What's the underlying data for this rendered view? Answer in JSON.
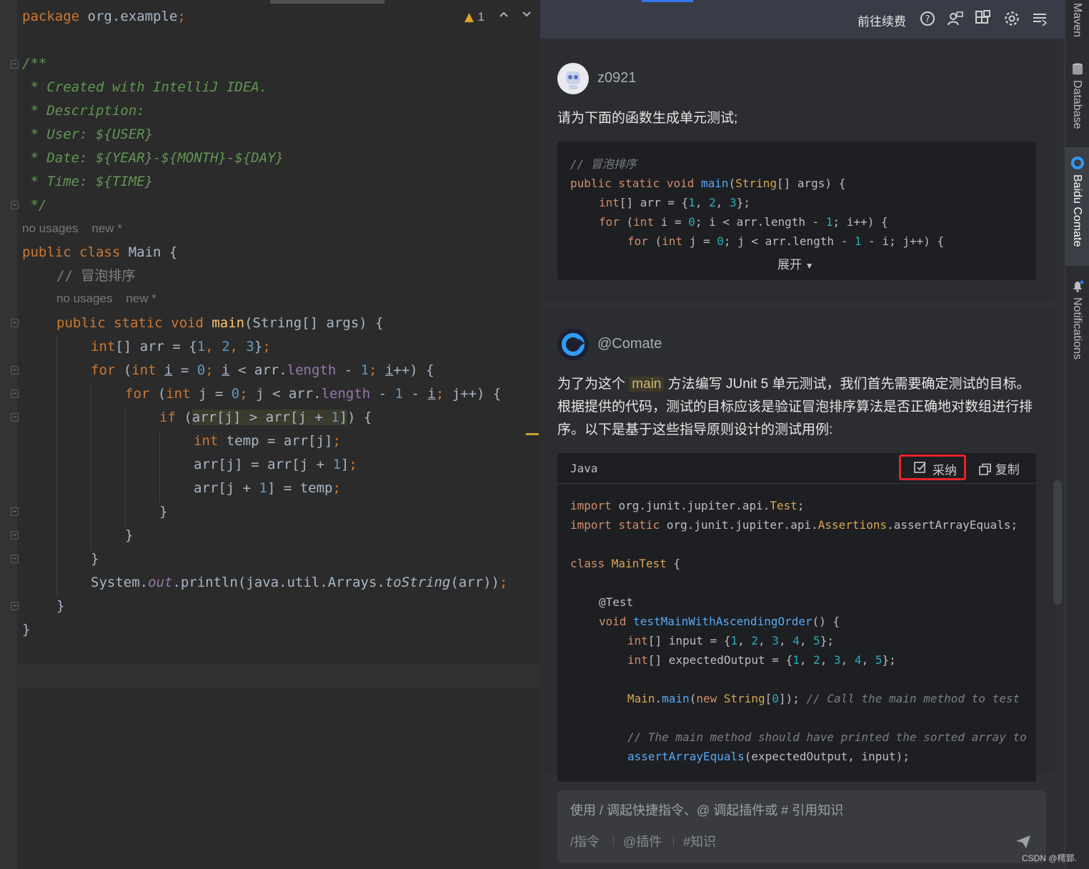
{
  "editor": {
    "package_kw": "package",
    "package_name": " org.example",
    "semicolon": ";",
    "warning_count": "1",
    "doc": [
      "/**",
      " * Created with IntelliJ IDEA.",
      " * Description:",
      " * User: ${USER}",
      " * Date: ${YEAR}-${MONTH}-${DAY}",
      " * Time: ${TIME}",
      " */"
    ],
    "hint_no_usages": "no usages",
    "hint_new": "new *",
    "class_line": {
      "kw": "public class ",
      "name": "Main {"
    },
    "comment_bubble": "// 冒泡排序",
    "closing_brace": "}",
    "println": {
      "a": "System.",
      "b": "out",
      "c": ".println(java.util.Arrays.",
      "d": "toString",
      "e": "(arr))"
    }
  },
  "panel": {
    "renew_label": "前往续费",
    "user": {
      "name": "z0921",
      "prompt": "请为下面的函数生成单元测试;",
      "code_comment": "// 冒泡排序",
      "expand_label": "展开"
    },
    "bot": {
      "name": "@Comate",
      "reply_before": "为了为这个",
      "reply_chip": "main",
      "reply_after": "方法编写 JUnit 5 单元测试，我们首先需要确定测试的目标。根据提供的代码，测试的目标应该是验证冒泡排序算法是否正确地对数组进行排序。以下是基于这些指导原则设计的测试用例:",
      "code_lang": "Java",
      "adopt_label": "采纳",
      "copy_label": "复制",
      "inline_comment_1": "// Call the main method to test",
      "inline_comment_2": "// The main method should have printed the sorted array to"
    },
    "input": {
      "placeholder": "使用 / 调起快捷指令、@ 调起插件或 # 引用知识",
      "shortcut_command": "/指令",
      "shortcut_plugin": "@插件",
      "shortcut_knowledge": "#知识"
    }
  },
  "toolwindows": {
    "maven": "Maven",
    "database": "Database",
    "comate": "Baidu Comate",
    "notifications": "Notifications"
  },
  "watermark": "CSDN @樗郅.",
  "colors": {
    "editor_bg": "#2b2b2b",
    "keyword": "#cc7832",
    "number": "#6897bb",
    "doc_comment": "#629755",
    "panel_bg": "#2b2d30",
    "adopt_border": "#e8232a",
    "accent": "#3574f0"
  }
}
